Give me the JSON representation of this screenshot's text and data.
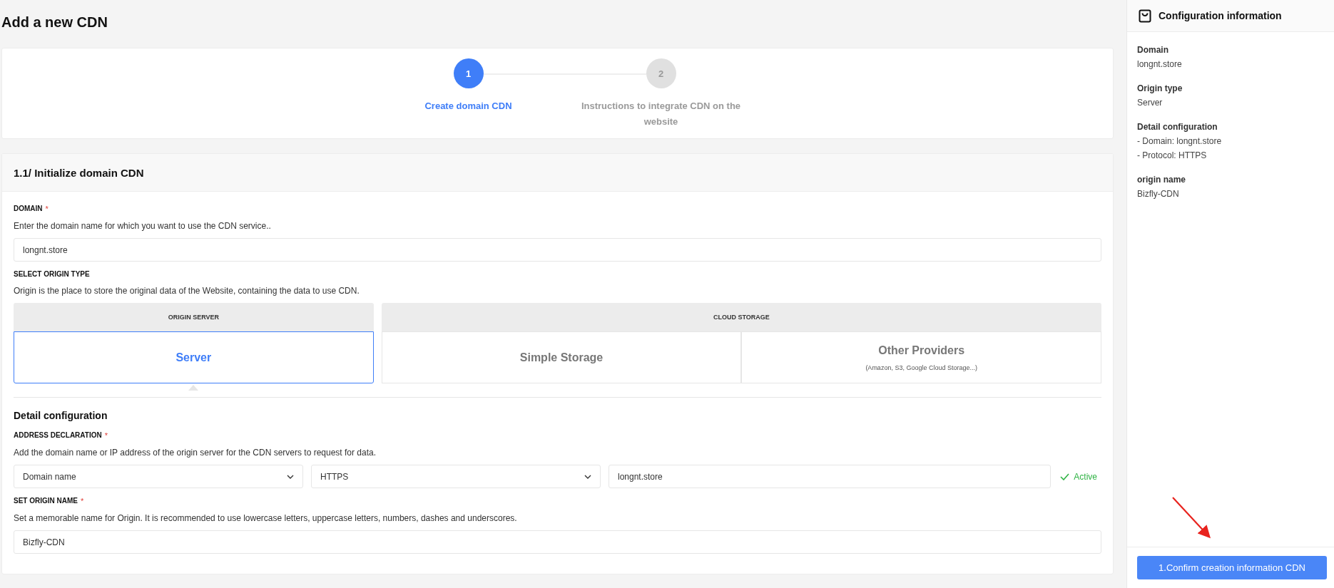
{
  "page": {
    "title": "Add a new CDN"
  },
  "steps": [
    {
      "number": "1",
      "label": "Create domain CDN",
      "active": true
    },
    {
      "number": "2",
      "label": "Instructions to integrate CDN on the website",
      "active": false
    }
  ],
  "form": {
    "title": "1.1/ Initialize domain CDN",
    "domain": {
      "label": "DOMAIN",
      "required_mark": "*",
      "help": "Enter the domain name for which you want to use the CDN service..",
      "value": "longnt.store"
    },
    "origin_type": {
      "label": "SELECT ORIGIN TYPE",
      "help": "Origin is the place to store the original data of the Website, containing the data to use CDN.",
      "groups": [
        {
          "header": "ORIGIN SERVER",
          "options": [
            {
              "title": "Server",
              "selected": true
            }
          ]
        },
        {
          "header": "CLOUD STORAGE",
          "options": [
            {
              "title": "Simple Storage",
              "selected": false
            },
            {
              "title": "Other Providers",
              "subtitle": "(Amazon, S3, Google Cloud Storage...)",
              "selected": false
            }
          ]
        }
      ]
    },
    "detail_title": "Detail configuration",
    "address": {
      "label": "ADDRESS DECLARATION",
      "required_mark": "*",
      "help": "Add the domain name or IP address of the origin server for the CDN servers to request for data.",
      "selects": [
        {
          "value": "Domain name"
        },
        {
          "value": "HTTPS"
        }
      ],
      "value": "longnt.store",
      "status": "Active"
    },
    "origin_name": {
      "label": "SET ORIGIN NAME",
      "required_mark": "*",
      "help": "Set a memorable name for Origin. It is recommended to use lowercase letters, uppercase letters, numbers, dashes and underscores.",
      "value": "Bizfly-CDN"
    }
  },
  "sidebar": {
    "title": "Configuration information",
    "items": [
      {
        "label": "Domain",
        "lines": [
          "longnt.store"
        ]
      },
      {
        "label": "Origin type",
        "lines": [
          "Server"
        ]
      },
      {
        "label": "Detail configuration",
        "lines": [
          "- Domain: longnt.store",
          "- Protocol: HTTPS"
        ]
      },
      {
        "label": "origin name",
        "lines": [
          "Bizfly-CDN"
        ]
      }
    ],
    "button": "1.Confirm creation information CDN"
  }
}
